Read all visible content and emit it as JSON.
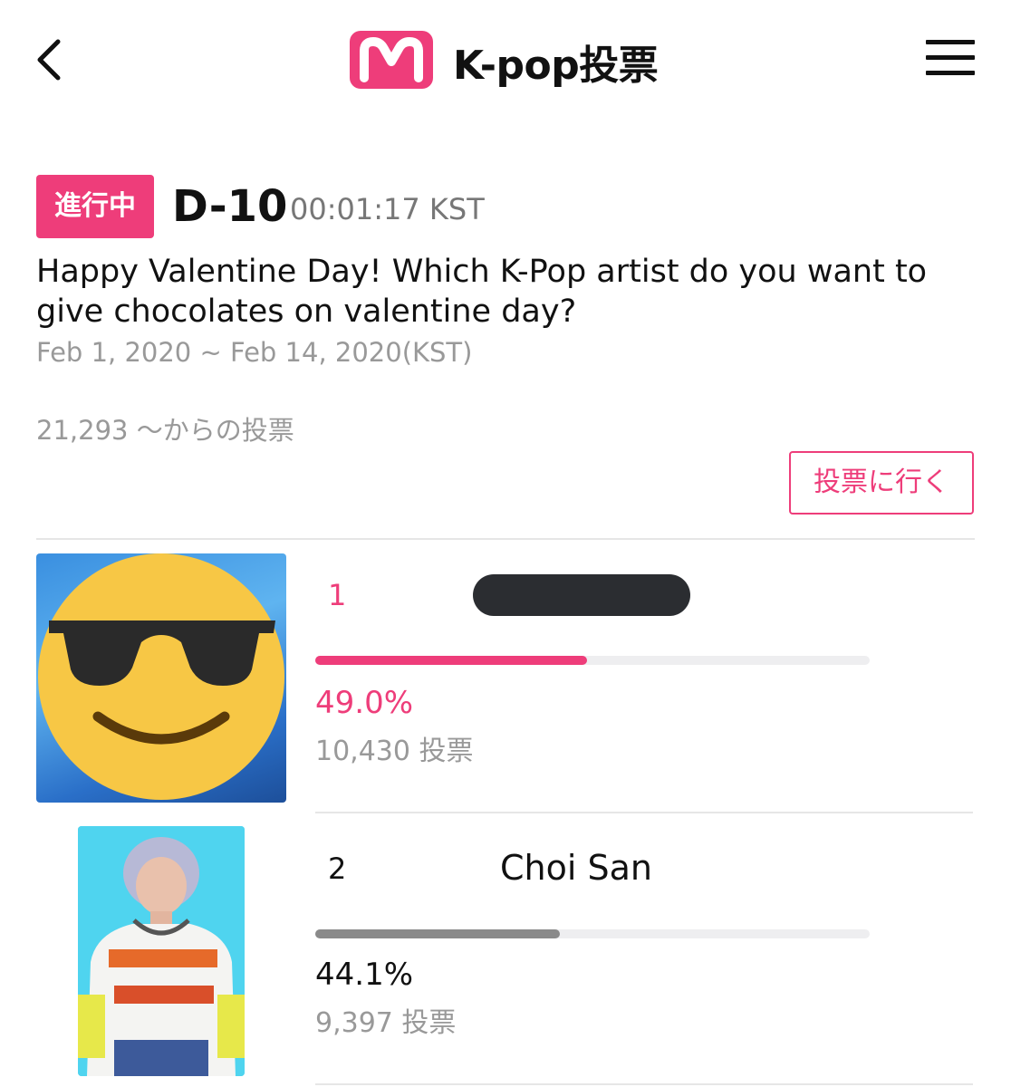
{
  "header": {
    "back_icon": "chevron-left-icon",
    "logo_letter": "M",
    "title": "K-pop投票",
    "menu_icon": "hamburger-menu-icon"
  },
  "vote": {
    "status": "進行中",
    "d_day": "D-10",
    "timer": "00:01:17 KST",
    "title": "Happy Valentine Day! Which K-Pop artist do you want to give chocolates on valentine day?",
    "period": "Feb 1, 2020 ~ Feb 14, 2020(KST)",
    "count_text": "21,293 ～からの投票",
    "go_vote_label": "投票に行く"
  },
  "colors": {
    "accent": "#ee3d7a",
    "second_bar": "#8a8a8a",
    "bar_track": "#eeeef0"
  },
  "rankings": [
    {
      "rank": "1",
      "name": "",
      "name_redacted": true,
      "percent_label": "49.0%",
      "percent": 49.0,
      "votes": "10,430 投票",
      "photo_icon": "sunglasses-emoji-icon"
    },
    {
      "rank": "2",
      "name": "Choi San",
      "name_redacted": false,
      "percent_label": "44.1%",
      "percent": 44.1,
      "votes": "9,397 投票",
      "photo_icon": "artist-photo"
    }
  ]
}
